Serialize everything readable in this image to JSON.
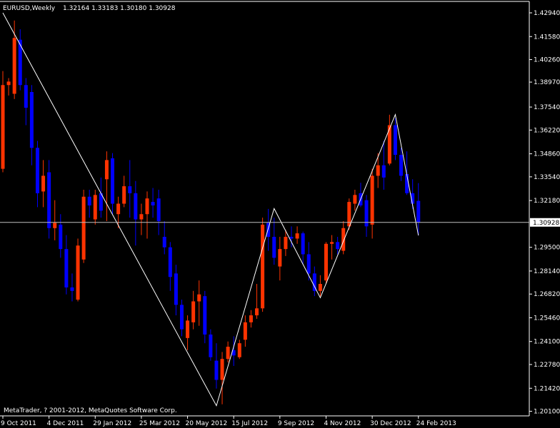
{
  "header": {
    "symbol": "EURUSD,Weekly",
    "ohlc": "1.32164 1.33183 1.30180 1.30928"
  },
  "footer": {
    "copyright": "MetaTrader, ? 2001-2012, MetaQuotes Software Corp."
  },
  "colors": {
    "background": "#000000",
    "bull": "#ff3300",
    "bear": "#0000ff",
    "wick_bull": "#ff3300",
    "wick_bear": "#0000ff",
    "axis": "#ffffff",
    "zigzag": "#ffffff",
    "price_line": "#c0c0c0"
  },
  "chart_data": {
    "type": "candlestick",
    "title": "EURUSD,Weekly",
    "ylim": [
      1.2,
      1.4294
    ],
    "y_ticks": [
      "1.42940",
      "1.41580",
      "1.40260",
      "1.38970",
      "1.37540",
      "1.36220",
      "1.34860",
      "1.33540",
      "1.32180",
      "1.30928",
      "1.29500",
      "1.28140",
      "1.26820",
      "1.25460",
      "1.24100",
      "1.22780",
      "1.21420",
      "1.20100"
    ],
    "x_tick_labels": [
      "9 Oct 2011",
      "4 Dec 2011",
      "29 Jan 2012",
      "25 Mar 2012",
      "20 May 2012",
      "15 Jul 2012",
      "9 Sep 2012",
      "4 Nov 2012",
      "30 Dec 2012",
      "24 Feb 2013"
    ],
    "x_tick_indices": [
      0,
      8,
      16,
      24,
      32,
      40,
      48,
      56,
      64,
      72
    ],
    "current_price": 1.30928,
    "current_price_label": "1.30928",
    "candles": [
      {
        "o": 1.34,
        "h": 1.396,
        "l": 1.338,
        "c": 1.388
      },
      {
        "o": 1.388,
        "h": 1.392,
        "l": 1.382,
        "c": 1.39
      },
      {
        "o": 1.383,
        "h": 1.425,
        "l": 1.38,
        "c": 1.415
      },
      {
        "o": 1.414,
        "h": 1.42,
        "l": 1.385,
        "c": 1.388
      },
      {
        "o": 1.388,
        "h": 1.392,
        "l": 1.365,
        "c": 1.375
      },
      {
        "o": 1.384,
        "h": 1.388,
        "l": 1.342,
        "c": 1.352
      },
      {
        "o": 1.352,
        "h": 1.356,
        "l": 1.318,
        "c": 1.326
      },
      {
        "o": 1.327,
        "h": 1.345,
        "l": 1.318,
        "c": 1.336
      },
      {
        "o": 1.338,
        "h": 1.345,
        "l": 1.3,
        "c": 1.306
      },
      {
        "o": 1.306,
        "h": 1.322,
        "l": 1.299,
        "c": 1.309
      },
      {
        "o": 1.308,
        "h": 1.314,
        "l": 1.289,
        "c": 1.294
      },
      {
        "o": 1.294,
        "h": 1.302,
        "l": 1.268,
        "c": 1.272
      },
      {
        "o": 1.272,
        "h": 1.28,
        "l": 1.264,
        "c": 1.27
      },
      {
        "o": 1.265,
        "h": 1.3,
        "l": 1.264,
        "c": 1.296
      },
      {
        "o": 1.288,
        "h": 1.328,
        "l": 1.286,
        "c": 1.324
      },
      {
        "o": 1.324,
        "h": 1.328,
        "l": 1.312,
        "c": 1.319
      },
      {
        "o": 1.311,
        "h": 1.328,
        "l": 1.308,
        "c": 1.325
      },
      {
        "o": 1.326,
        "h": 1.335,
        "l": 1.312,
        "c": 1.316
      },
      {
        "o": 1.334,
        "h": 1.35,
        "l": 1.31,
        "c": 1.345
      },
      {
        "o": 1.346,
        "h": 1.349,
        "l": 1.314,
        "c": 1.32
      },
      {
        "o": 1.314,
        "h": 1.324,
        "l": 1.306,
        "c": 1.32
      },
      {
        "o": 1.32,
        "h": 1.336,
        "l": 1.318,
        "c": 1.33
      },
      {
        "o": 1.33,
        "h": 1.345,
        "l": 1.312,
        "c": 1.326
      },
      {
        "o": 1.326,
        "h": 1.333,
        "l": 1.296,
        "c": 1.311
      },
      {
        "o": 1.311,
        "h": 1.32,
        "l": 1.302,
        "c": 1.314
      },
      {
        "o": 1.314,
        "h": 1.327,
        "l": 1.3,
        "c": 1.323
      },
      {
        "o": 1.321,
        "h": 1.329,
        "l": 1.312,
        "c": 1.319
      },
      {
        "o": 1.323,
        "h": 1.328,
        "l": 1.302,
        "c": 1.31
      },
      {
        "o": 1.301,
        "h": 1.31,
        "l": 1.291,
        "c": 1.295
      },
      {
        "o": 1.295,
        "h": 1.298,
        "l": 1.27,
        "c": 1.278
      },
      {
        "o": 1.28,
        "h": 1.285,
        "l": 1.256,
        "c": 1.262
      },
      {
        "o": 1.262,
        "h": 1.265,
        "l": 1.244,
        "c": 1.248
      },
      {
        "o": 1.243,
        "h": 1.256,
        "l": 1.236,
        "c": 1.253
      },
      {
        "o": 1.252,
        "h": 1.27,
        "l": 1.248,
        "c": 1.264
      },
      {
        "o": 1.264,
        "h": 1.276,
        "l": 1.25,
        "c": 1.268
      },
      {
        "o": 1.267,
        "h": 1.27,
        "l": 1.24,
        "c": 1.245
      },
      {
        "o": 1.245,
        "h": 1.248,
        "l": 1.23,
        "c": 1.232
      },
      {
        "o": 1.23,
        "h": 1.24,
        "l": 1.214,
        "c": 1.219
      },
      {
        "o": 1.219,
        "h": 1.235,
        "l": 1.205,
        "c": 1.231
      },
      {
        "o": 1.231,
        "h": 1.241,
        "l": 1.229,
        "c": 1.238
      },
      {
        "o": 1.236,
        "h": 1.244,
        "l": 1.227,
        "c": 1.233
      },
      {
        "o": 1.232,
        "h": 1.242,
        "l": 1.231,
        "c": 1.24
      },
      {
        "o": 1.242,
        "h": 1.256,
        "l": 1.238,
        "c": 1.252
      },
      {
        "o": 1.252,
        "h": 1.259,
        "l": 1.249,
        "c": 1.256
      },
      {
        "o": 1.256,
        "h": 1.274,
        "l": 1.254,
        "c": 1.26
      },
      {
        "o": 1.26,
        "h": 1.312,
        "l": 1.258,
        "c": 1.308
      },
      {
        "o": 1.309,
        "h": 1.317,
        "l": 1.293,
        "c": 1.301
      },
      {
        "o": 1.301,
        "h": 1.312,
        "l": 1.285,
        "c": 1.289
      },
      {
        "o": 1.284,
        "h": 1.301,
        "l": 1.276,
        "c": 1.294
      },
      {
        "o": 1.294,
        "h": 1.305,
        "l": 1.29,
        "c": 1.301
      },
      {
        "o": 1.301,
        "h": 1.307,
        "l": 1.295,
        "c": 1.3
      },
      {
        "o": 1.3,
        "h": 1.307,
        "l": 1.297,
        "c": 1.303
      },
      {
        "o": 1.303,
        "h": 1.304,
        "l": 1.285,
        "c": 1.291
      },
      {
        "o": 1.291,
        "h": 1.298,
        "l": 1.276,
        "c": 1.28
      },
      {
        "o": 1.28,
        "h": 1.284,
        "l": 1.267,
        "c": 1.27
      },
      {
        "o": 1.27,
        "h": 1.279,
        "l": 1.267,
        "c": 1.274
      },
      {
        "o": 1.276,
        "h": 1.298,
        "l": 1.274,
        "c": 1.297
      },
      {
        "o": 1.297,
        "h": 1.302,
        "l": 1.288,
        "c": 1.298
      },
      {
        "o": 1.298,
        "h": 1.301,
        "l": 1.291,
        "c": 1.294
      },
      {
        "o": 1.293,
        "h": 1.31,
        "l": 1.291,
        "c": 1.306
      },
      {
        "o": 1.307,
        "h": 1.323,
        "l": 1.305,
        "c": 1.321
      },
      {
        "o": 1.32,
        "h": 1.328,
        "l": 1.316,
        "c": 1.325
      },
      {
        "o": 1.326,
        "h": 1.332,
        "l": 1.318,
        "c": 1.319
      },
      {
        "o": 1.322,
        "h": 1.325,
        "l": 1.301,
        "c": 1.307
      },
      {
        "o": 1.308,
        "h": 1.34,
        "l": 1.3,
        "c": 1.336
      },
      {
        "o": 1.336,
        "h": 1.349,
        "l": 1.329,
        "c": 1.342
      },
      {
        "o": 1.342,
        "h": 1.356,
        "l": 1.328,
        "c": 1.335
      },
      {
        "o": 1.343,
        "h": 1.371,
        "l": 1.342,
        "c": 1.365
      },
      {
        "o": 1.365,
        "h": 1.369,
        "l": 1.345,
        "c": 1.348
      },
      {
        "o": 1.348,
        "h": 1.352,
        "l": 1.333,
        "c": 1.336
      },
      {
        "o": 1.337,
        "h": 1.35,
        "l": 1.325,
        "c": 1.326
      },
      {
        "o": 1.326,
        "h": 1.334,
        "l": 1.317,
        "c": 1.32
      },
      {
        "o": 1.3216,
        "h": 1.3318,
        "l": 1.3018,
        "c": 1.3093
      }
    ],
    "zigzag": [
      {
        "i": 0,
        "price": 1.4294
      },
      {
        "i": 37,
        "price": 1.2042
      },
      {
        "i": 47,
        "price": 1.3172
      },
      {
        "i": 55,
        "price": 1.2661
      },
      {
        "i": 68,
        "price": 1.3711
      },
      {
        "i": 72,
        "price": 1.3018
      }
    ]
  }
}
